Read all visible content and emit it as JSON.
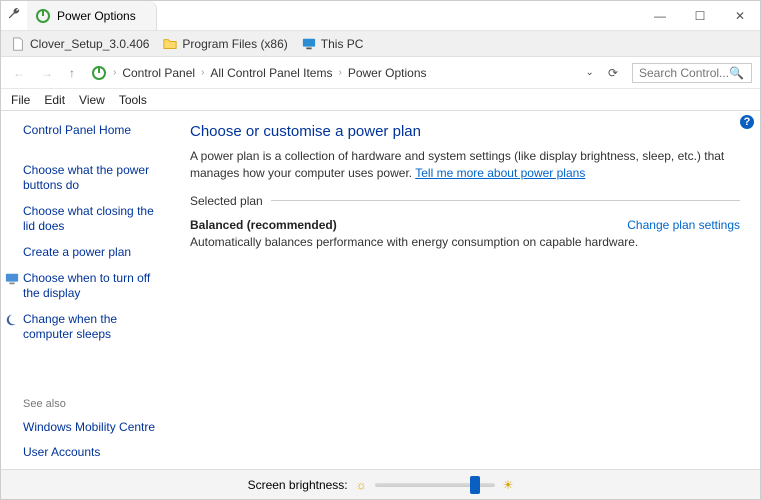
{
  "window": {
    "title": "Power Options"
  },
  "bookmarks": [
    {
      "label": "Clover_Setup_3.0.406",
      "icon": "file"
    },
    {
      "label": "Program Files (x86)",
      "icon": "folder"
    },
    {
      "label": "This PC",
      "icon": "pc"
    }
  ],
  "breadcrumbs": [
    "Control Panel",
    "All Control Panel Items",
    "Power Options"
  ],
  "search_placeholder": "Search Control...",
  "menubar": [
    "File",
    "Edit",
    "View",
    "Tools"
  ],
  "sidebar": {
    "home": "Control Panel Home",
    "links": [
      "Choose what the power buttons do",
      "Choose what closing the lid does",
      "Create a power plan",
      "Choose when to turn off the display",
      "Change when the computer sleeps"
    ],
    "see_also_label": "See also",
    "see_also": [
      "Windows Mobility Centre",
      "User Accounts"
    ]
  },
  "main": {
    "heading": "Choose or customise a power plan",
    "desc_a": "A power plan is a collection of hardware and system settings (like display brightness, sleep, etc.) that manages how your computer uses power. ",
    "desc_link": "Tell me more about power plans",
    "section_label": "Selected plan",
    "plan_name": "Balanced (recommended)",
    "plan_link": "Change plan settings",
    "plan_desc": "Automatically balances performance with energy consumption on capable hardware."
  },
  "footer": {
    "label": "Screen brightness:"
  }
}
